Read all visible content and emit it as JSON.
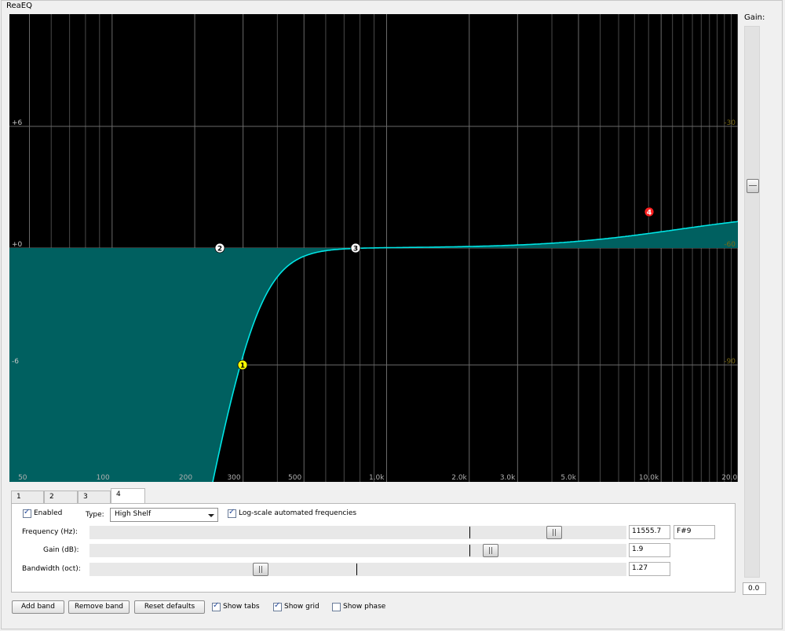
{
  "window": {
    "title": "ReaEQ"
  },
  "graph": {
    "db_labels": [
      "+6",
      "+0",
      "-6"
    ],
    "phase_labels": [
      "-30",
      "-60",
      "-90"
    ],
    "freq_labels": [
      "50",
      "100",
      "200",
      "300",
      "500",
      "1.0k",
      "2.0k",
      "3.0k",
      "5.0k",
      "10.0k",
      "20.0k"
    ],
    "colors": {
      "background": "#000000",
      "grid": "#6a6a6a",
      "curve": "#00e5e5",
      "fill": "#006060",
      "phase_label": "#7a6a14"
    }
  },
  "bands": [
    {
      "id": "1",
      "color": "#ffff00",
      "text_color": "#000000"
    },
    {
      "id": "2",
      "color": "#ffffff",
      "text_color": "#000000"
    },
    {
      "id": "3",
      "color": "#ffffff",
      "text_color": "#000000"
    },
    {
      "id": "4",
      "color": "#ff2020",
      "text_color": "#ffffff"
    }
  ],
  "gain": {
    "label": "Gain:",
    "value": "0.0"
  },
  "tabs": [
    "1",
    "2",
    "3",
    "4"
  ],
  "active_tab": "4",
  "band_panel": {
    "enabled_label": "Enabled",
    "enabled": true,
    "type_label": "Type:",
    "type_value": "High Shelf",
    "logscale_label": "Log-scale automated frequencies",
    "logscale": true,
    "frequency_label": "Frequency (Hz):",
    "frequency_value": "11555.7",
    "note_value": "F#9",
    "gain_label": "Gain (dB):",
    "gain_value": "1.9",
    "bandwidth_label": "Bandwidth (oct):",
    "bandwidth_value": "1.27"
  },
  "bottom": {
    "add_band": "Add band",
    "remove_band": "Remove band",
    "reset_defaults": "Reset defaults",
    "show_tabs": "Show tabs",
    "show_tabs_checked": true,
    "show_grid": "Show grid",
    "show_grid_checked": true,
    "show_phase": "Show phase",
    "show_phase_checked": false
  }
}
